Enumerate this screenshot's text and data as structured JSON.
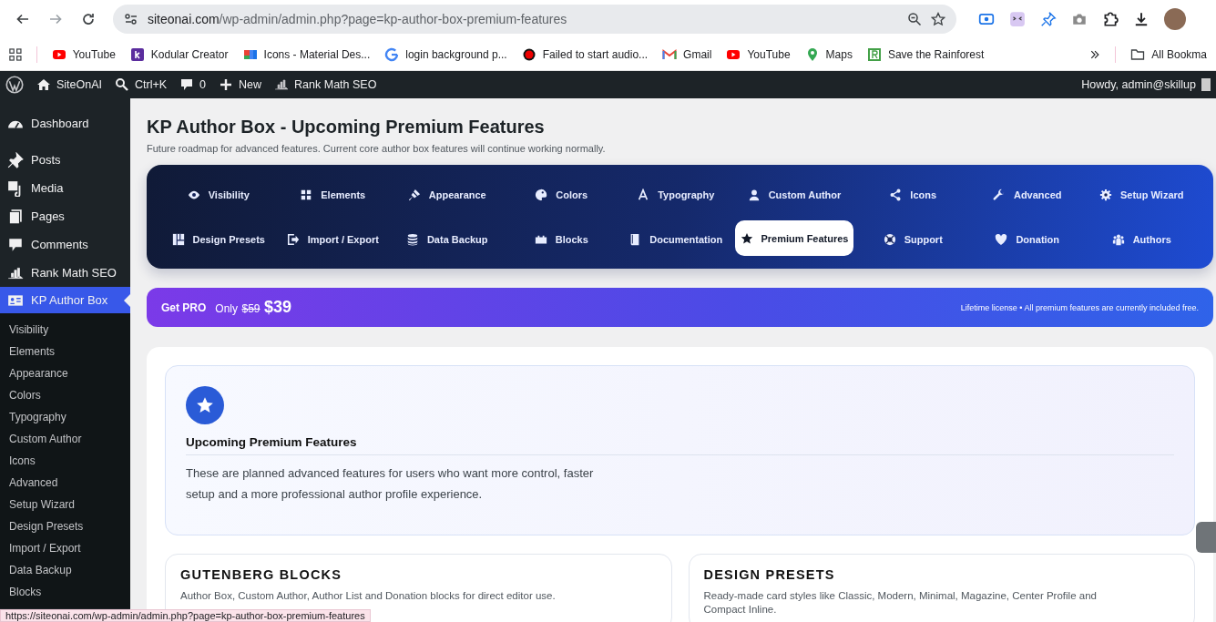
{
  "browser": {
    "url_host": "siteonai.com",
    "url_path": "/wp-admin/admin.php?page=kp-author-box-premium-features",
    "forward_disabled": true
  },
  "bookmarks": [
    {
      "label": "YouTube"
    },
    {
      "label": "Kodular Creator"
    },
    {
      "label": "Icons - Material Des..."
    },
    {
      "label": "login background p..."
    },
    {
      "label": "Failed to start audio..."
    },
    {
      "label": "Gmail"
    },
    {
      "label": "YouTube"
    },
    {
      "label": "Maps"
    },
    {
      "label": "Save the Rainforest"
    }
  ],
  "bookmarks_folder": "All Bookma",
  "admin_bar": {
    "items": [
      "SiteOnAI",
      "Ctrl+K",
      "0",
      "New",
      "Rank Math SEO"
    ],
    "greeting": "Howdy, admin@skillup"
  },
  "sidebar": {
    "items": [
      {
        "label": "Dashboard",
        "selected": false
      },
      {
        "label": "Posts",
        "selected": false
      },
      {
        "label": "Media",
        "selected": false
      },
      {
        "label": "Pages",
        "selected": false
      },
      {
        "label": "Comments",
        "selected": false
      },
      {
        "label": "Rank Math SEO",
        "selected": false
      },
      {
        "label": "KP Author Box",
        "selected": true
      }
    ],
    "submenu": [
      "Visibility",
      "Elements",
      "Appearance",
      "Colors",
      "Typography",
      "Custom Author",
      "Icons",
      "Advanced",
      "Setup Wizard",
      "Design Presets",
      "Import / Export",
      "Data Backup",
      "Blocks"
    ]
  },
  "page": {
    "title": "KP Author Box - Upcoming Premium Features",
    "subtitle": "Future roadmap for advanced features. Current core author box features will continue working normally."
  },
  "tabs": [
    {
      "label": "Visibility",
      "selected": false
    },
    {
      "label": "Elements",
      "selected": false
    },
    {
      "label": "Appearance",
      "selected": false
    },
    {
      "label": "Colors",
      "selected": false
    },
    {
      "label": "Typography",
      "selected": false
    },
    {
      "label": "Custom Author",
      "selected": false
    },
    {
      "label": "Icons",
      "selected": false
    },
    {
      "label": "Advanced",
      "selected": false
    },
    {
      "label": "Setup Wizard",
      "selected": false
    },
    {
      "label": "Design Presets",
      "selected": false
    },
    {
      "label": "Import / Export",
      "selected": false
    },
    {
      "label": "Data Backup",
      "selected": false
    },
    {
      "label": "Blocks",
      "selected": false
    },
    {
      "label": "Documentation",
      "selected": false
    },
    {
      "label": "Premium Features",
      "selected": true
    },
    {
      "label": "Support",
      "selected": false
    },
    {
      "label": "Donation",
      "selected": false
    },
    {
      "label": "Authors",
      "selected": false
    }
  ],
  "promo": {
    "label": "Get PRO",
    "only": "Only",
    "old_price": "$59",
    "price": "$39",
    "note": "Lifetime license • All premium features are currently included free."
  },
  "intro": {
    "title": "Upcoming Premium Features",
    "text": "These are planned advanced features for users who want more control, faster setup and a more professional author profile experience."
  },
  "features": [
    {
      "title": "GUTENBERG BLOCKS",
      "text": "Author Box, Custom Author, Author List and Donation blocks for direct editor use."
    },
    {
      "title": "DESIGN PRESETS",
      "text": "Ready-made card styles like Classic, Modern, Minimal, Magazine, Center Profile and Compact Inline."
    }
  ],
  "status_url": "https://siteonai.com/wp-admin/admin.php?page=kp-author-box-premium-features"
}
